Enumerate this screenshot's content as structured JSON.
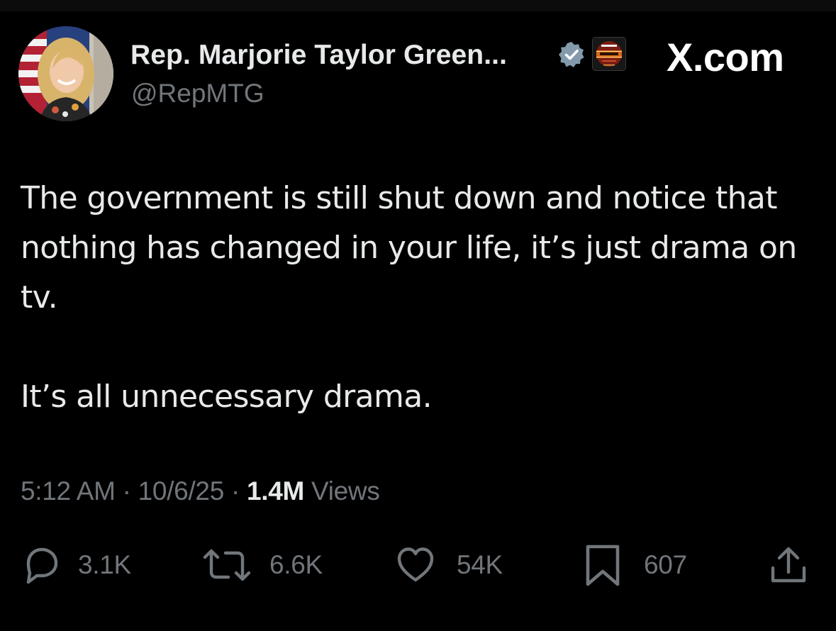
{
  "author": {
    "display_name": "Rep. Marjorie Taylor Green...",
    "handle": "@RepMTG",
    "verified_icon": "verified-badge-icon",
    "affiliate_badge": {
      "icon": "affiliate-badge-icon",
      "lettering": [
        "THIS IS A",
        "DEMOCRAT",
        "SHUTDOWN"
      ]
    }
  },
  "site_logo": "X.com",
  "tweet": {
    "paragraphs": [
      "The government is still shut down and notice that nothing has changed in your life, it’s just drama on tv.",
      "It’s all unnecessary drama."
    ]
  },
  "meta": {
    "time": "5:12 AM",
    "sep1": " · ",
    "date": "10/6/25",
    "sep2": " · ",
    "views_count": "1.4M",
    "views_label": " Views"
  },
  "actions": {
    "reply": {
      "icon": "reply-icon",
      "count": "3.1K"
    },
    "repost": {
      "icon": "repost-icon",
      "count": "6.6K"
    },
    "like": {
      "icon": "heart-icon",
      "count": "54K"
    },
    "bookmark": {
      "icon": "bookmark-icon",
      "count": "607"
    },
    "share": {
      "icon": "share-icon"
    }
  },
  "colors": {
    "background": "#000000",
    "primary_text": "#e7e9ea",
    "secondary_text": "#71767b",
    "verified": "#829aab"
  }
}
